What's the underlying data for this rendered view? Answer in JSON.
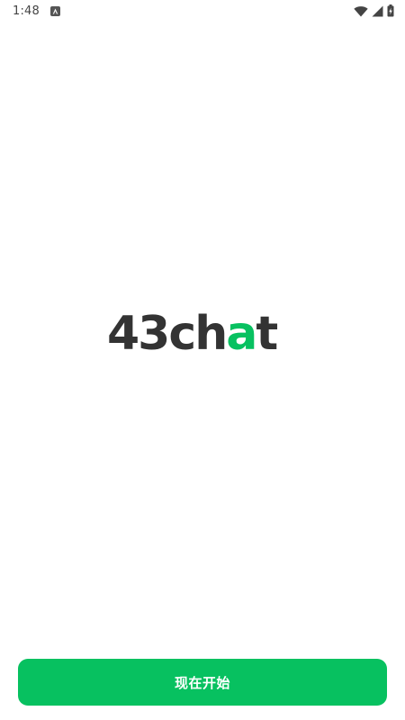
{
  "status_bar": {
    "time": "1:48",
    "notification_icon": "a-notification-icon",
    "wifi_icon": "wifi-icon",
    "cellular_icon": "cellular-signal-icon",
    "battery_icon": "battery-charging-icon"
  },
  "logo": {
    "text": "43chat",
    "part_dark_1": "43ch",
    "part_accent": "a",
    "part_dark_2": "t",
    "dark_color": "#333333",
    "accent_color": "#07c160"
  },
  "start_button": {
    "label": "现在开始",
    "color": "#07c160"
  }
}
